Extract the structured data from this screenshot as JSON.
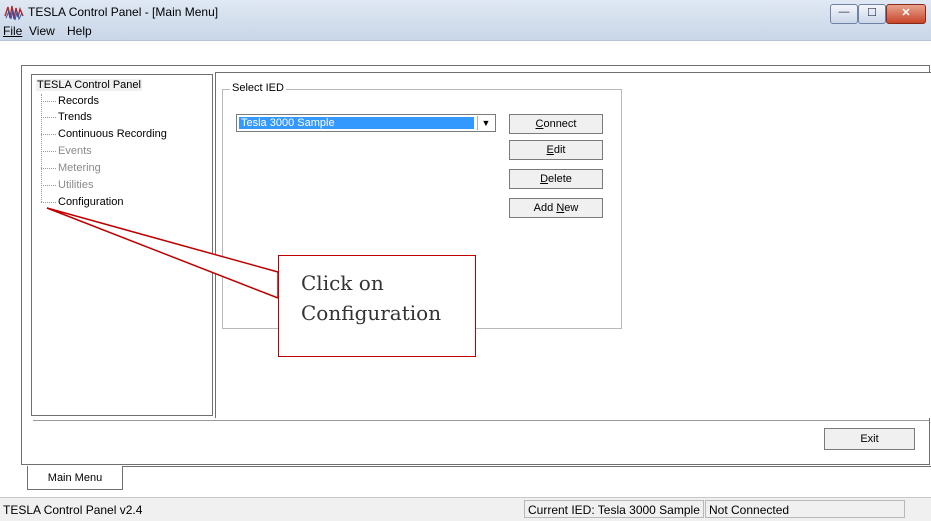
{
  "window": {
    "title": "TESLA Control Panel - [Main Menu]",
    "min_glyph": "—",
    "max_glyph": "☐",
    "close_glyph": "✕"
  },
  "menu": {
    "file": "File",
    "view": "View",
    "help": "Help"
  },
  "tree": {
    "root": "TESLA Control Panel",
    "items": [
      {
        "label": "Records",
        "enabled": true
      },
      {
        "label": "Trends",
        "enabled": true
      },
      {
        "label": "Continuous Recording",
        "enabled": true
      },
      {
        "label": "Events",
        "enabled": false
      },
      {
        "label": "Metering",
        "enabled": false
      },
      {
        "label": "Utilities",
        "enabled": false
      },
      {
        "label": "Configuration",
        "enabled": true
      }
    ]
  },
  "select_ied": {
    "group_label": "Select IED",
    "selected": "Tesla 3000 Sample",
    "arrow_glyph": "▼"
  },
  "buttons": {
    "connect": {
      "pre": "",
      "key": "C",
      "post": "onnect"
    },
    "edit": {
      "pre": "",
      "key": "E",
      "post": "dit"
    },
    "delete": {
      "pre": "",
      "key": "D",
      "post": "elete"
    },
    "add_new": {
      "pre": "Add ",
      "key": "N",
      "post": "ew"
    },
    "exit": "Exit"
  },
  "tabs": {
    "main_menu": "Main Menu"
  },
  "status": {
    "version": "TESLA Control Panel v2.4",
    "current_ied": "Current IED:  Tesla 3000 Sample",
    "connection": "Not Connected"
  },
  "callout": {
    "line1": "Click on",
    "line2": "Configuration",
    "color": "#c00000"
  }
}
